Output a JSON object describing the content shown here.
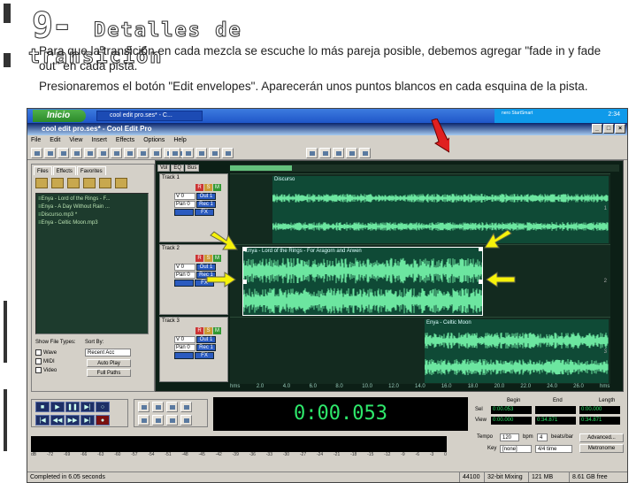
{
  "slide": {
    "title_number": "9-",
    "title_line1": "Detalles de",
    "title_line2": "transición",
    "paragraph1": "Para que la transición en cada mezcla se escuche lo más pareja posible, debemos agregar \"fade in y fade out\" en cada pista.",
    "paragraph2": "Presionaremos el botón \"Edit envelopes\". Aparecerán unos puntos  blancos en cada esquina de la pista."
  },
  "taskbar": {
    "start_label": "Inicio",
    "task_label": "cool edit pro.ses* - C...",
    "clock": "2:34",
    "tray_logo": "nero StartSmart"
  },
  "window": {
    "title": "cool edit pro.ses* - Cool Edit Pro",
    "menus": [
      "File",
      "Edit",
      "View",
      "Insert",
      "Effects",
      "Options",
      "Help"
    ]
  },
  "organizer": {
    "tabs": [
      "Files",
      "Effects",
      "Favorites"
    ],
    "files": [
      "Enya - Lord of the Rings - F...",
      "Enya - A Day Without Rain ...",
      "Discurso.mp3 *",
      "Enya - Celtic Moon.mp3"
    ],
    "show_types_label": "Show File Types:",
    "sort_by_label": "Sort By:",
    "types": [
      "Wave",
      "MIDI",
      "Video"
    ],
    "sort_value": "Recent Acc",
    "auto_play": "Auto Play",
    "full_paths": "Full Paths"
  },
  "multitrack": {
    "tabs": [
      "Vol",
      "EQ",
      "Bus"
    ],
    "tracks": [
      {
        "name": "Track 1",
        "clip": "Discurso",
        "lane_no": "1"
      },
      {
        "name": "Track 2",
        "clip": "Enya - Lord of the Rings - For Aragorn and Arwen",
        "lane_no": "2"
      },
      {
        "name": "Track 3",
        "clip": "Enya - Celtic Moon",
        "lane_no": "3"
      }
    ],
    "ctl": {
      "vo": "V 0",
      "pan": "Pan 0",
      "out": "Out 1",
      "rec": "Rec 1",
      "fx": "FX",
      "r": "R",
      "s": "S",
      "m": "M"
    },
    "timeline": [
      "hms",
      "2.0",
      "4.0",
      "6.0",
      "8.0",
      "10.0",
      "12.0",
      "14.0",
      "16.0",
      "18.0",
      "20.0",
      "22.0",
      "24.0",
      "26.0",
      "hms"
    ]
  },
  "transport": {
    "time": "0:00.053",
    "sel_headers": [
      "Begin",
      "End",
      "Length"
    ],
    "sel_label": "Sel",
    "view_label": "View",
    "sel_begin": "0:00.053",
    "sel_end": "",
    "sel_length": "0:00.000",
    "view_begin": "0:00.000",
    "view_end": "0:34.871",
    "view_length": "0:34.871",
    "meter_scale": [
      "dB",
      "-72",
      "-69",
      "-66",
      "-63",
      "-60",
      "-57",
      "-54",
      "-51",
      "-48",
      "-45",
      "-42",
      "-39",
      "-36",
      "-33",
      "-30",
      "-27",
      "-24",
      "-21",
      "-18",
      "-15",
      "-12",
      "-9",
      "-6",
      "-3",
      "0"
    ],
    "tempo_label": "Tempo",
    "tempo": "120",
    "bpm": "bpm",
    "beats": "4",
    "beats_label": "beats/bar",
    "advanced": "Advanced...",
    "key_label": "Key",
    "key": "[none]",
    "time_sig": "4/4 time",
    "metronome": "Metronome"
  },
  "status": {
    "message": "Completed in 6.05 seconds",
    "rate": "44100",
    "bits": "32-bit Mixing",
    "mem": "121 MB",
    "free": "8.61 GB free"
  },
  "colors": {
    "arrow_yellow": "#f6f20a",
    "arrow_red": "#e02020",
    "wave_green": "#6ce6a0",
    "display_green": "#2ee86b"
  }
}
